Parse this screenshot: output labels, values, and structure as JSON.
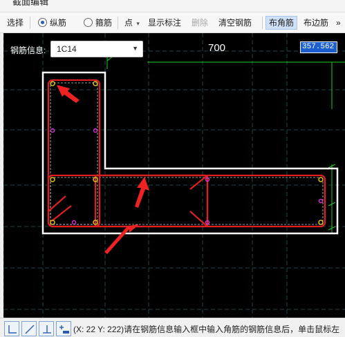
{
  "window": {
    "title": "截面编辑"
  },
  "toolbar": {
    "select_label": "选择",
    "radio_longitudinal": "纵筋",
    "radio_stirrup": "箍筋",
    "point_label": "点",
    "point_caret": "▾",
    "show_dim_label": "显示标注",
    "delete_label": "删除",
    "clear_label": "清空钢筋",
    "corner_label": "布角筋",
    "edge_label": "布边筋",
    "more_label": "»"
  },
  "canvas": {
    "info_label": "钢筋信息:",
    "rebar_value": "1C14",
    "dimension_text": "700",
    "dimension_input": "357.562"
  },
  "statusbar": {
    "message": "(X: 22 Y: 222)请在钢筋信息输入框中输入角筋的钢筋信息后，单击鼠标左"
  },
  "colors": {
    "canvas_bg": "#000000",
    "section_outline": "#ffffff",
    "rebar": "#e02020",
    "dim_line": "#22cc22",
    "grid": "#1e4a4a",
    "selected_input": "#1e5fd0",
    "active_tool": "#cfe1f7"
  }
}
